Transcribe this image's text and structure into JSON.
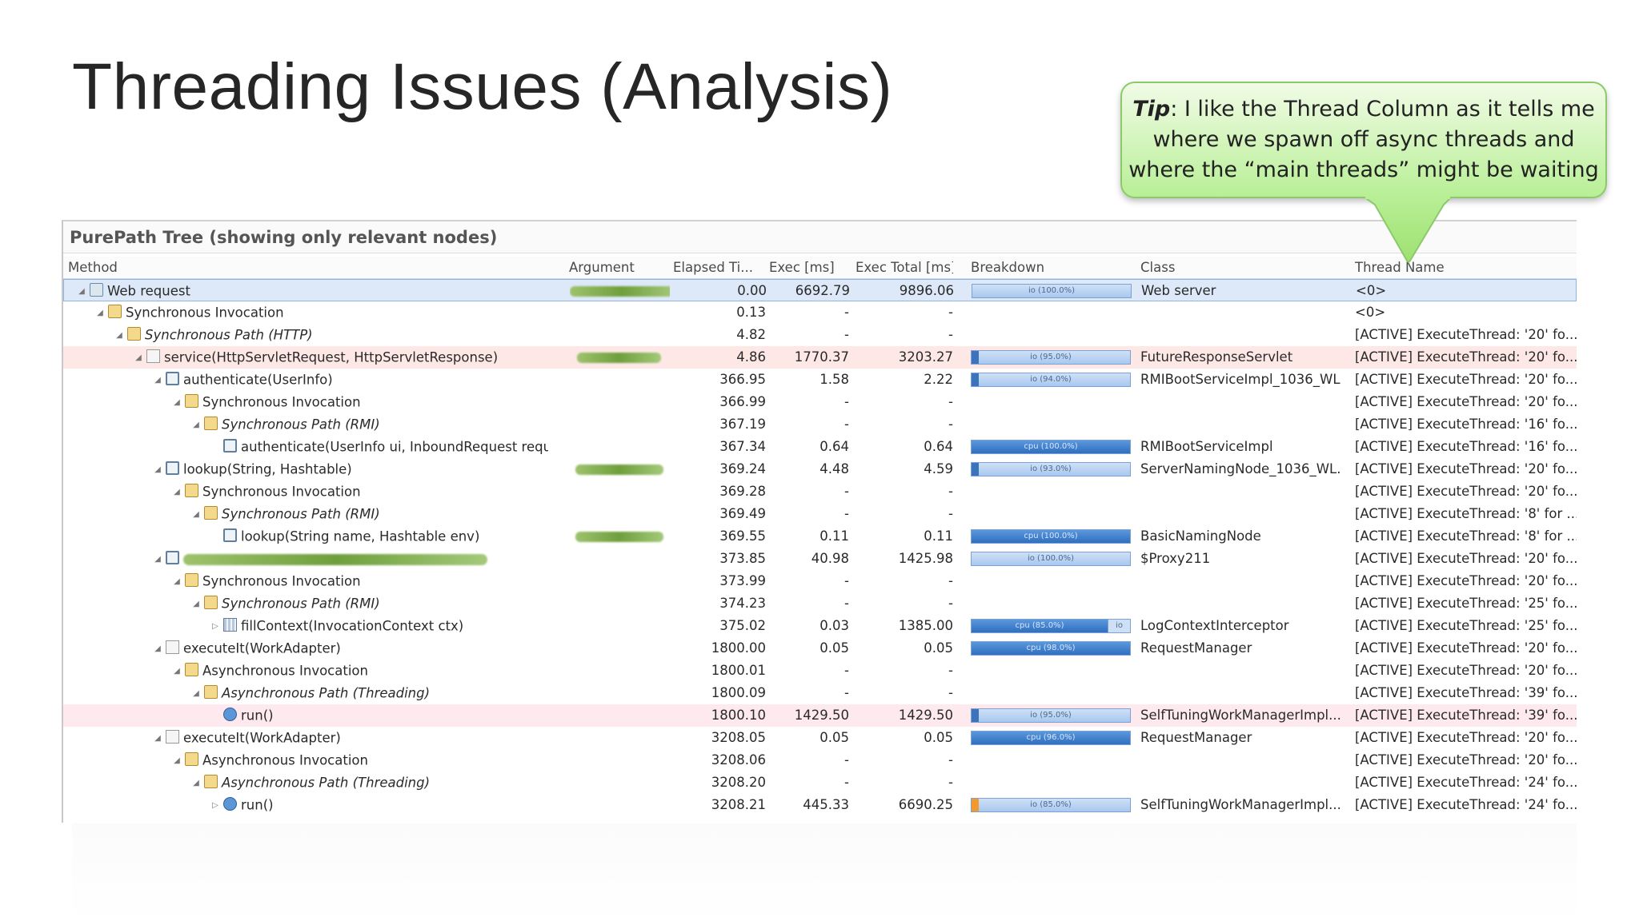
{
  "slide": {
    "title": "Threading Issues (Analysis)"
  },
  "tip": {
    "label": "Tip",
    "line1": ": I like the Thread Column as it tells me",
    "line2": "where we spawn off async threads and",
    "line3": "where the “main threads” might be waiting"
  },
  "panel": {
    "title": "PurePath Tree (showing only relevant nodes)",
    "columns": {
      "method": "Method",
      "argument": "Argument",
      "elapsed": "Elapsed Ti...",
      "exec": "Exec [ms]",
      "total": "Exec Total [ms]",
      "breakdown": "Breakdown",
      "class": "Class",
      "thread": "Thread Name"
    },
    "rows": [
      {
        "method": "Web request",
        "elapsed": "0.00",
        "exec": "6692.79",
        "total": "9896.06",
        "breakdown": "io (100.0%)",
        "class": "Web server",
        "thread": "<0>"
      },
      {
        "method": "Synchronous Invocation",
        "elapsed": "0.13",
        "exec": "-",
        "total": "-",
        "breakdown": "",
        "class": "",
        "thread": "<0>"
      },
      {
        "method": "Synchronous Path (HTTP)",
        "elapsed": "4.82",
        "exec": "-",
        "total": "-",
        "breakdown": "",
        "class": "",
        "thread": "[ACTIVE] ExecuteThread: '20' fo..."
      },
      {
        "method": "service(HttpServletRequest, HttpServletResponse)",
        "elapsed": "4.86",
        "exec": "1770.37",
        "total": "3203.27",
        "breakdown": "io (95.0%)",
        "class": "FutureResponseServlet",
        "thread": "[ACTIVE] ExecuteThread: '20' fo..."
      },
      {
        "method": "authenticate(UserInfo)",
        "elapsed": "366.95",
        "exec": "1.58",
        "total": "2.22",
        "breakdown": "io (94.0%)",
        "class": "RMIBootServiceImpl_1036_WL...",
        "thread": "[ACTIVE] ExecuteThread: '20' fo..."
      },
      {
        "method": "Synchronous Invocation",
        "elapsed": "366.99",
        "exec": "-",
        "total": "-",
        "breakdown": "",
        "class": "",
        "thread": "[ACTIVE] ExecuteThread: '20' fo..."
      },
      {
        "method": "Synchronous Path (RMI)",
        "elapsed": "367.19",
        "exec": "-",
        "total": "-",
        "breakdown": "",
        "class": "",
        "thread": "[ACTIVE] ExecuteThread: '16' fo..."
      },
      {
        "method": "authenticate(UserInfo ui, InboundRequest requ",
        "elapsed": "367.34",
        "exec": "0.64",
        "total": "0.64",
        "breakdown": "cpu (100.0%)",
        "class": "RMIBootServiceImpl",
        "thread": "[ACTIVE] ExecuteThread: '16' fo..."
      },
      {
        "method": "lookup(String, Hashtable)",
        "elapsed": "369.24",
        "exec": "4.48",
        "total": "4.59",
        "breakdown": "io (93.0%)",
        "class": "ServerNamingNode_1036_WL...",
        "thread": "[ACTIVE] ExecuteThread: '20' fo..."
      },
      {
        "method": "Synchronous Invocation",
        "elapsed": "369.28",
        "exec": "-",
        "total": "-",
        "breakdown": "",
        "class": "",
        "thread": "[ACTIVE] ExecuteThread: '20' fo..."
      },
      {
        "method": "Synchronous Path (RMI)",
        "elapsed": "369.49",
        "exec": "-",
        "total": "-",
        "breakdown": "",
        "class": "",
        "thread": "[ACTIVE] ExecuteThread: '8' for ..."
      },
      {
        "method": "lookup(String name, Hashtable env)",
        "elapsed": "369.55",
        "exec": "0.11",
        "total": "0.11",
        "breakdown": "cpu (100.0%)",
        "class": "BasicNamingNode",
        "thread": "[ACTIVE] ExecuteThread: '8' for ..."
      },
      {
        "method": "",
        "elapsed": "373.85",
        "exec": "40.98",
        "total": "1425.98",
        "breakdown": "io (100.0%)",
        "class": "$Proxy211",
        "thread": "[ACTIVE] ExecuteThread: '20' fo..."
      },
      {
        "method": "Synchronous Invocation",
        "elapsed": "373.99",
        "exec": "-",
        "total": "-",
        "breakdown": "",
        "class": "",
        "thread": "[ACTIVE] ExecuteThread: '20' fo..."
      },
      {
        "method": "Synchronous Path (RMI)",
        "elapsed": "374.23",
        "exec": "-",
        "total": "-",
        "breakdown": "",
        "class": "",
        "thread": "[ACTIVE] ExecuteThread: '25' fo..."
      },
      {
        "method": "fillContext(InvocationContext ctx)",
        "elapsed": "375.02",
        "exec": "0.03",
        "total": "1385.00",
        "breakdown": "cpu (85.0%)",
        "breakdown2": "io",
        "class": "LogContextInterceptor",
        "thread": "[ACTIVE] ExecuteThread: '25' fo..."
      },
      {
        "method": "executeIt(WorkAdapter)",
        "elapsed": "1800.00",
        "exec": "0.05",
        "total": "0.05",
        "breakdown": "cpu (98.0%)",
        "class": "RequestManager",
        "thread": "[ACTIVE] ExecuteThread: '20' fo..."
      },
      {
        "method": "Asynchronous Invocation",
        "elapsed": "1800.01",
        "exec": "-",
        "total": "-",
        "breakdown": "",
        "class": "",
        "thread": "[ACTIVE] ExecuteThread: '20' fo..."
      },
      {
        "method": "Asynchronous Path (Threading)",
        "elapsed": "1800.09",
        "exec": "-",
        "total": "-",
        "breakdown": "",
        "class": "",
        "thread": "[ACTIVE] ExecuteThread: '39' fo..."
      },
      {
        "method": "run()",
        "elapsed": "1800.10",
        "exec": "1429.50",
        "total": "1429.50",
        "breakdown": "io (95.0%)",
        "class": "SelfTuningWorkManagerImpl...",
        "thread": "[ACTIVE] ExecuteThread: '39' fo..."
      },
      {
        "method": "executeIt(WorkAdapter)",
        "elapsed": "3208.05",
        "exec": "0.05",
        "total": "0.05",
        "breakdown": "cpu (96.0%)",
        "class": "RequestManager",
        "thread": "[ACTIVE] ExecuteThread: '20' fo..."
      },
      {
        "method": "Asynchronous Invocation",
        "elapsed": "3208.06",
        "exec": "-",
        "total": "-",
        "breakdown": "",
        "class": "",
        "thread": "[ACTIVE] ExecuteThread: '20' fo..."
      },
      {
        "method": "Asynchronous Path (Threading)",
        "elapsed": "3208.20",
        "exec": "-",
        "total": "-",
        "breakdown": "",
        "class": "",
        "thread": "[ACTIVE] ExecuteThread: '24' fo..."
      },
      {
        "method": "run()",
        "elapsed": "3208.21",
        "exec": "445.33",
        "total": "6690.25",
        "breakdown": "io (85.0%)",
        "class": "SelfTuningWorkManagerImpl...",
        "thread": "[ACTIVE] ExecuteThread: '24' fo..."
      }
    ]
  },
  "colors": {
    "io": "#a9c8ef",
    "cpu": "#2f6fc1",
    "accent_green": "#b8ef96",
    "selection": "#dde9f8"
  }
}
